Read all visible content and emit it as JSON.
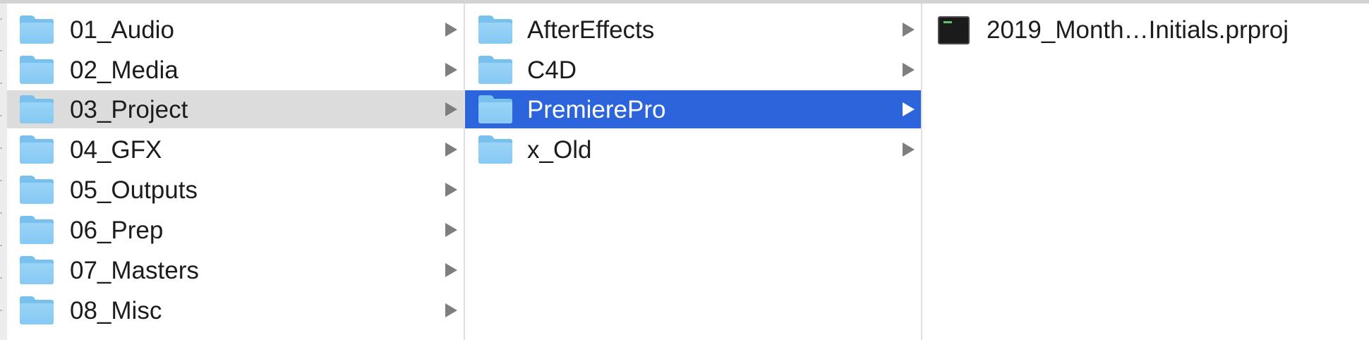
{
  "columns": {
    "col1": {
      "items": [
        {
          "label": "01_Audio",
          "icon": "folder-icon",
          "has_children": true
        },
        {
          "label": "02_Media",
          "icon": "folder-icon",
          "has_children": true
        },
        {
          "label": "03_Project",
          "icon": "folder-icon",
          "has_children": true,
          "state": "selected-inactive"
        },
        {
          "label": "04_GFX",
          "icon": "folder-icon",
          "has_children": true
        },
        {
          "label": "05_Outputs",
          "icon": "folder-icon",
          "has_children": true
        },
        {
          "label": "06_Prep",
          "icon": "folder-icon",
          "has_children": true
        },
        {
          "label": "07_Masters",
          "icon": "folder-icon",
          "has_children": true
        },
        {
          "label": "08_Misc",
          "icon": "folder-icon",
          "has_children": true
        }
      ]
    },
    "col2": {
      "items": [
        {
          "label": "AfterEffects",
          "icon": "folder-icon",
          "has_children": true
        },
        {
          "label": "C4D",
          "icon": "folder-icon",
          "has_children": true
        },
        {
          "label": "PremierePro",
          "icon": "folder-icon",
          "has_children": true,
          "state": "selected-active"
        },
        {
          "label": "x_Old",
          "icon": "folder-icon",
          "has_children": true
        }
      ]
    },
    "col3": {
      "items": [
        {
          "label": "2019_Month…Initials.prproj",
          "icon": "premiere-project-file-icon"
        }
      ]
    }
  },
  "colors": {
    "selection_active": "#2b64db",
    "selection_inactive": "#dcdcdc",
    "folder": "#86c9f3"
  }
}
